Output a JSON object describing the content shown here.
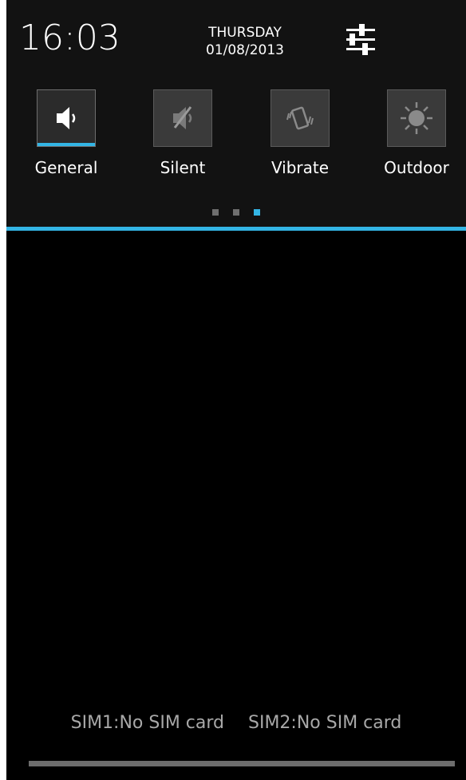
{
  "status_header": {
    "time": "16:03",
    "day": "THURSDAY",
    "date": "01/08/2013",
    "settings_icon": "quick-settings-sliders-icon"
  },
  "audio_profiles": {
    "items": [
      {
        "label": "General",
        "icon": "speaker-icon",
        "active": true
      },
      {
        "label": "Silent",
        "icon": "speaker-muted-icon",
        "active": false
      },
      {
        "label": "Vibrate",
        "icon": "vibrate-phone-icon",
        "active": false
      },
      {
        "label": "Outdoor",
        "icon": "sun-icon",
        "active": false
      }
    ],
    "pages": 3,
    "current_page": 3
  },
  "footer": {
    "sim1": "SIM1:No SIM card",
    "sim2": "SIM2:No SIM card"
  },
  "colors": {
    "accent": "#33b5e5",
    "panel_bg": "#121212",
    "background": "#000000",
    "text": "#ffffff",
    "muted_text": "#a8a8a8"
  }
}
